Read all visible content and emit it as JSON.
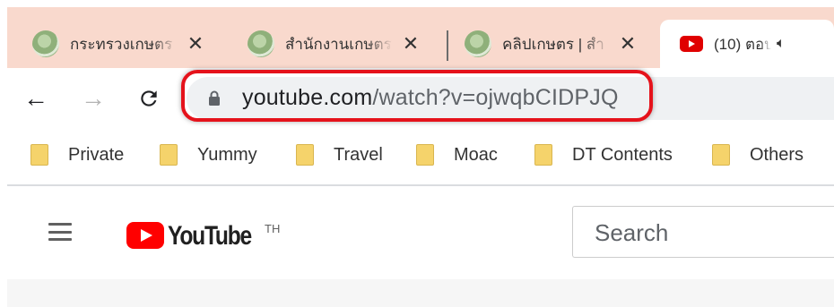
{
  "tabs": [
    {
      "title": "กระทรวงเกษตร",
      "close": "✕"
    },
    {
      "title": "สำนักงานเกษตร",
      "close": "✕"
    },
    {
      "title": "คลิปเกษตร | สำ",
      "close": "✕"
    },
    {
      "title": "(10) ตอบ",
      "audio_icon": "🔈︎"
    }
  ],
  "toolbar": {
    "back": "←",
    "forward": "→",
    "reload": "C",
    "url_domain": "youtube.com",
    "url_path": "/watch?v=ojwqbCIDPJQ"
  },
  "bookmarks": [
    "Private",
    "Yummy",
    "Travel",
    "Moac",
    "DT Contents",
    "Others"
  ],
  "youtube": {
    "logo_text": "YouTube",
    "region": "TH",
    "search_placeholder": "Search"
  },
  "colors": {
    "tabstrip_bg": "#f9d9cd",
    "highlight": "#e5121b",
    "youtube_red": "#ff0000",
    "bookmark_folder": "#f5d36b"
  }
}
